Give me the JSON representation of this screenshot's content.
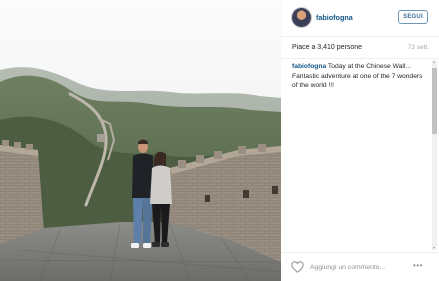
{
  "photo": {
    "description_icon": "photo-icon"
  },
  "header": {
    "username": "fabiofogna",
    "follow_label": "SEGUI"
  },
  "stats": {
    "likes": "Piace a 3,410 persone",
    "time_ago": "73 sett."
  },
  "caption": {
    "user": "fabiofogna",
    "text": " Today at the Chinese Wall... Fantastic adventure at one of the 7 wonders of the world !!!"
  },
  "footer": {
    "comment_placeholder": "Aggiungi un commento...",
    "more_label": "•••"
  },
  "colors": {
    "username_blue": "#125688",
    "follow_border": "#6f97b6",
    "follow_text": "#3f729b",
    "muted_text": "#a5a7aa"
  }
}
